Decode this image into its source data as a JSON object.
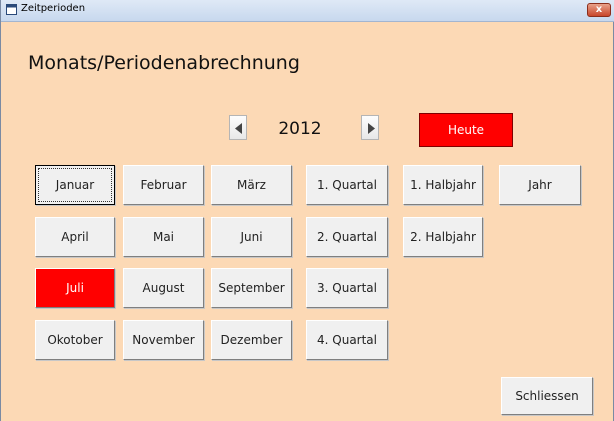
{
  "window": {
    "title": "Zeitperioden",
    "close_label": "x"
  },
  "heading": "Monats/Periodenabrechnung",
  "year_nav": {
    "year": "2012",
    "today_label": "Heute"
  },
  "months": {
    "jan": "Januar",
    "feb": "Februar",
    "mar": "März",
    "apr": "April",
    "may": "Mai",
    "jun": "Juni",
    "jul": "Juli",
    "aug": "August",
    "sep": "September",
    "oct": "Okotober",
    "nov": "November",
    "dec": "Dezember"
  },
  "quarters": {
    "q1": "1. Quartal",
    "q2": "2. Quartal",
    "q3": "3. Quartal",
    "q4": "4. Quartal"
  },
  "halves": {
    "h1": "1. Halbjahr",
    "h2": "2. Halbjahr"
  },
  "year_button": "Jahr",
  "close_button": "Schliessen",
  "colors": {
    "background": "#fcd9b5",
    "highlight": "#ff0000"
  },
  "selected_month": "Juli"
}
